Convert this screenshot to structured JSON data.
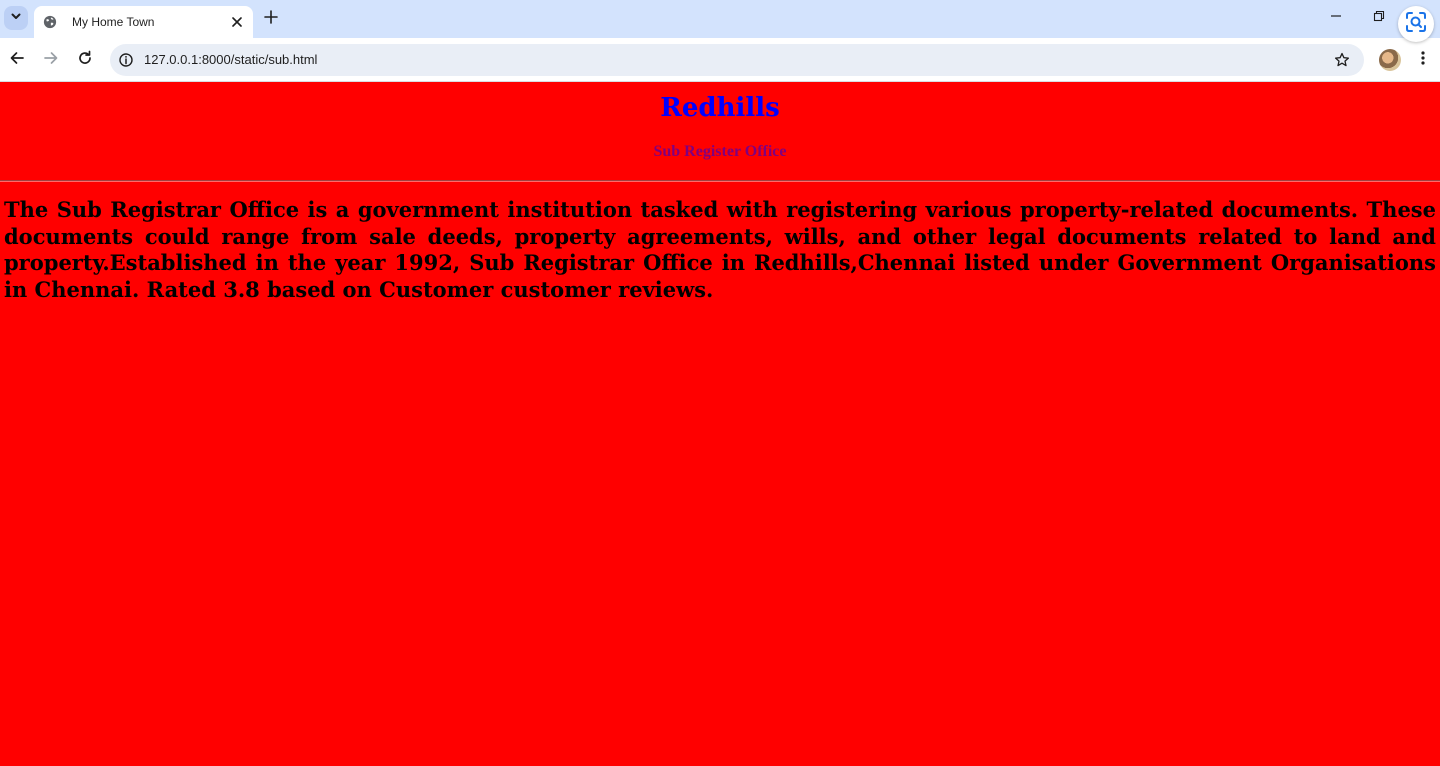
{
  "browser": {
    "tab": {
      "title": "My Home Town",
      "favicon": "globe-icon"
    },
    "address_bar": {
      "url": "127.0.0.1:8000/static/sub.html"
    }
  },
  "page": {
    "heading": "Redhills",
    "subheading": "Sub Register Office",
    "paragraph": "The Sub Registrar Office is a government institution tasked with registering various property-related documents. These documents could range from sale deeds, property agreements, wills, and other legal documents related to land and property.Established in the year 1992, Sub Registrar Office in Redhills,Chennai listed under Government Organisations in Chennai. Rated 3.8 based on Customer customer reviews.",
    "background_color": "#ff0000",
    "heading_color": "#0000ff",
    "subheading_color": "#800080"
  }
}
